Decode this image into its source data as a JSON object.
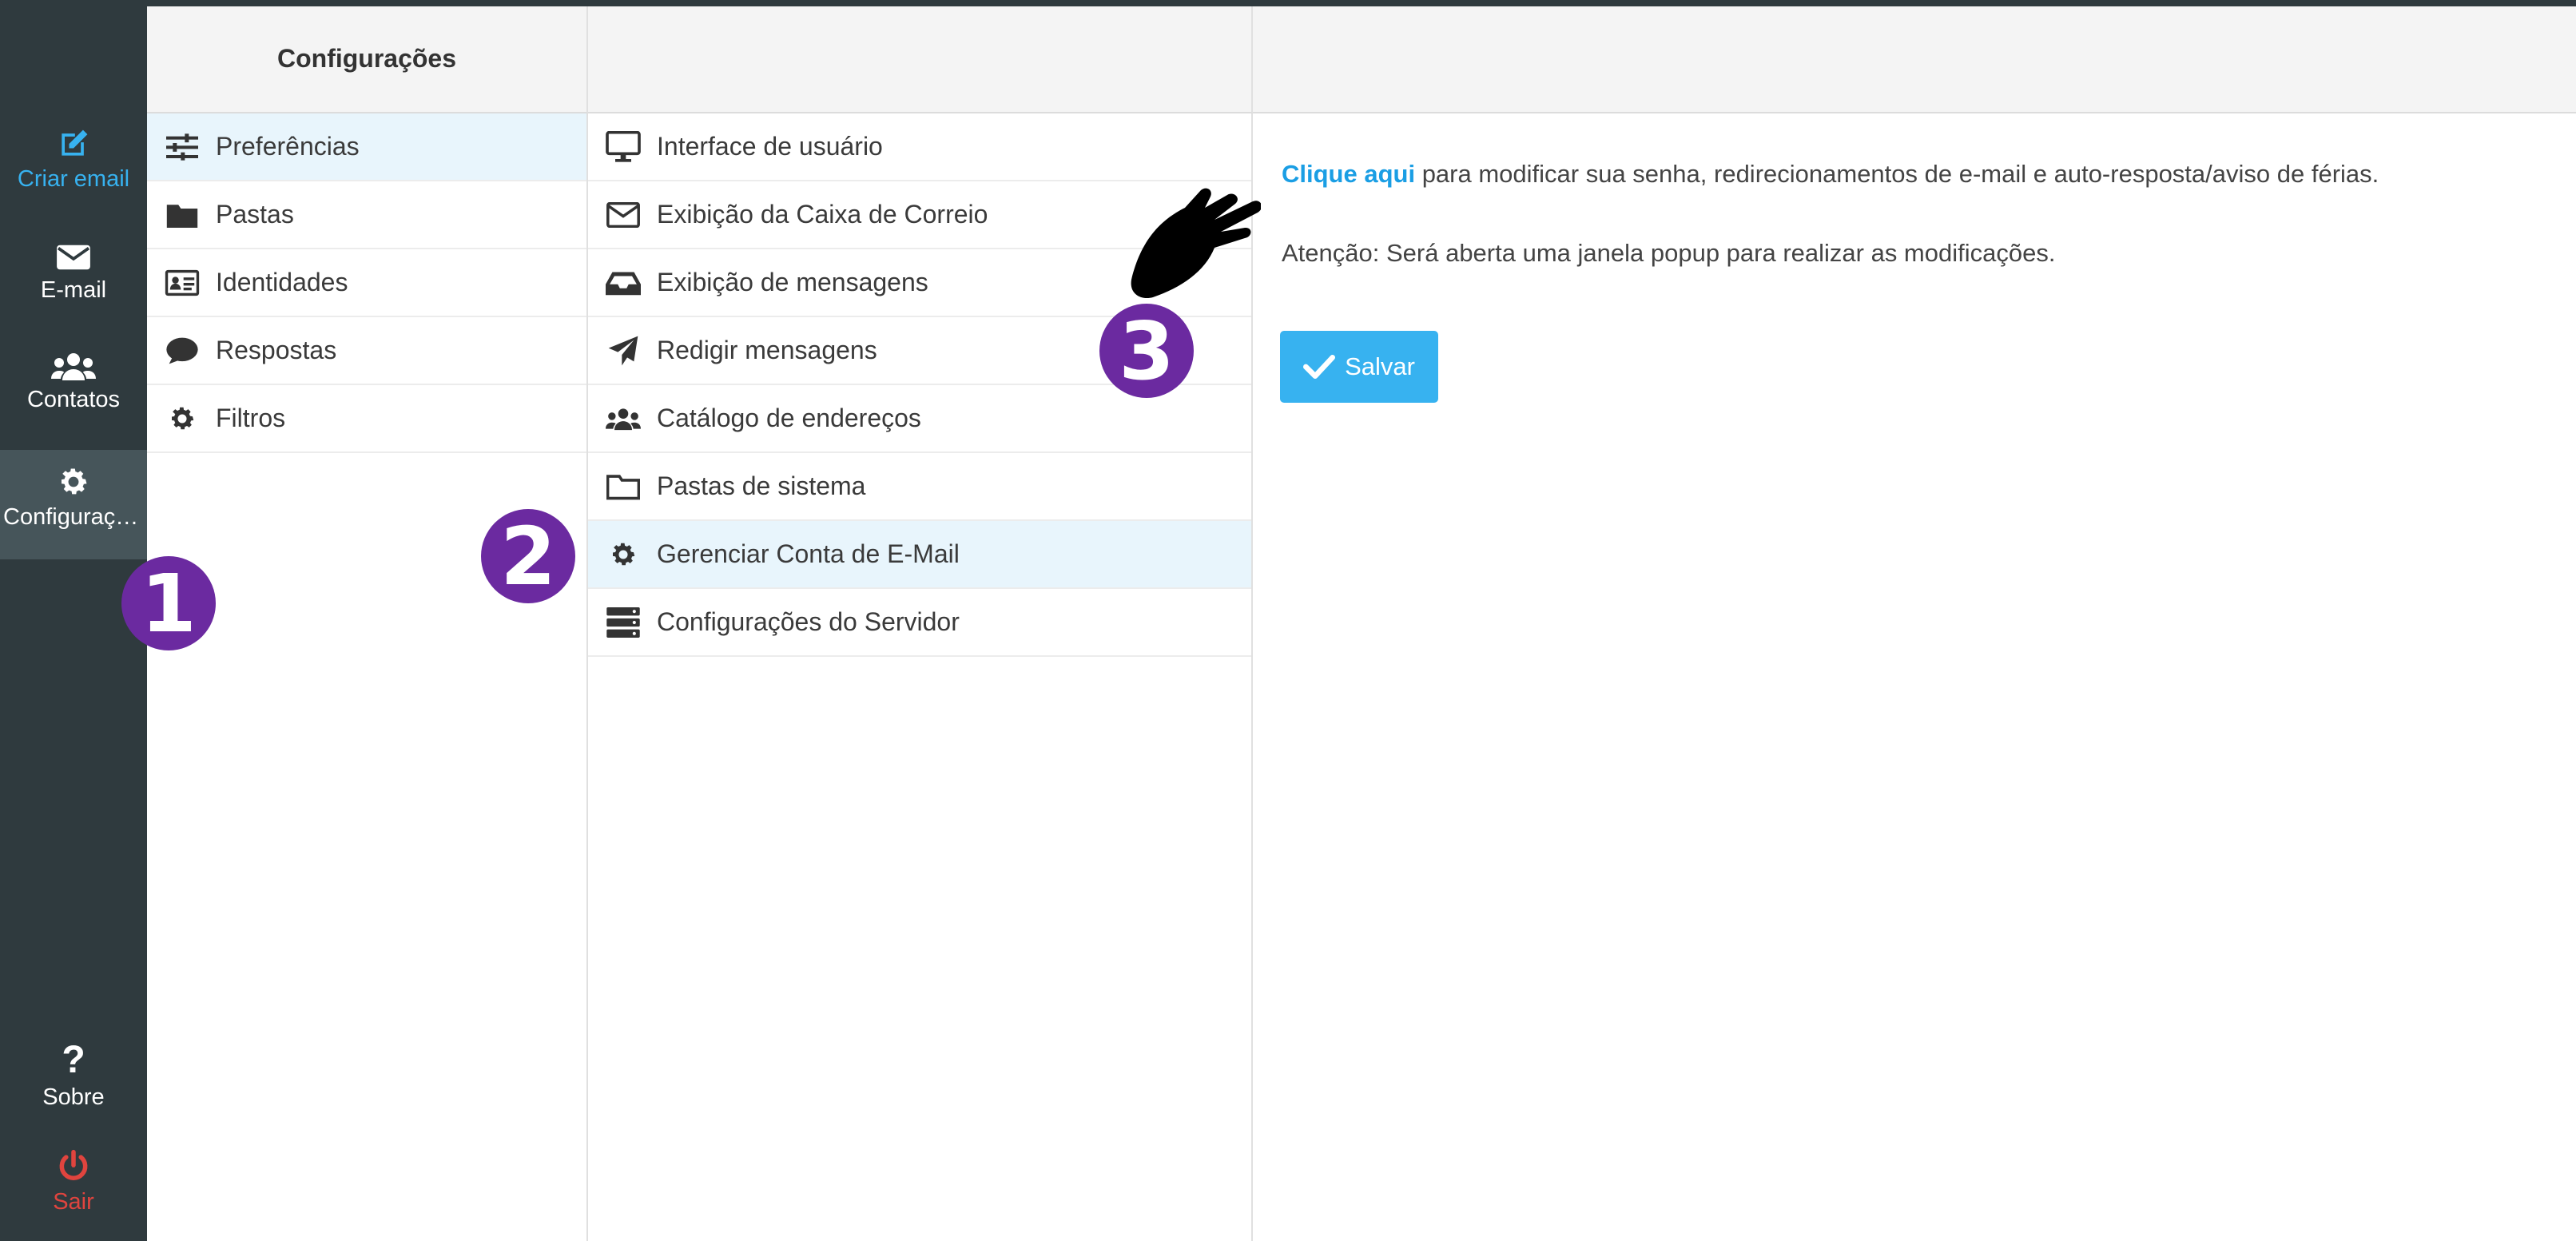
{
  "nav": {
    "compose": "Criar email",
    "mail": "E-mail",
    "contacts": "Contatos",
    "settings": "Configurações",
    "about": "Sobre",
    "logout": "Sair"
  },
  "settings_header": "Configurações",
  "sections": [
    {
      "label": "Preferências",
      "icon": "sliders-icon",
      "active": true
    },
    {
      "label": "Pastas",
      "icon": "folder-icon"
    },
    {
      "label": "Identidades",
      "icon": "id-card-icon"
    },
    {
      "label": "Respostas",
      "icon": "comment-icon"
    },
    {
      "label": "Filtros",
      "icon": "gear-icon"
    }
  ],
  "preferences": [
    {
      "label": "Interface de usuário",
      "icon": "monitor-icon"
    },
    {
      "label": "Exibição da Caixa de Correio",
      "icon": "envelope-icon"
    },
    {
      "label": "Exibição de mensagens",
      "icon": "inbox-icon"
    },
    {
      "label": "Redigir mensagens",
      "icon": "paper-plane-icon"
    },
    {
      "label": "Catálogo de endereços",
      "icon": "users-icon"
    },
    {
      "label": "Pastas de sistema",
      "icon": "folder-outline-icon"
    },
    {
      "label": "Gerenciar Conta de E-Mail",
      "icon": "gear-icon",
      "active": true
    },
    {
      "label": "Configurações do Servidor",
      "icon": "server-icon"
    }
  ],
  "content": {
    "link_text": "Clique aqui",
    "line1_rest": " para modificar sua senha, redirecionamentos de e-mail e auto-resposta/aviso de férias.",
    "line2": "Atenção: Será aberta uma janela popup para realizar as modificações.",
    "save_label": "Salvar"
  },
  "annotations": {
    "step1": "1",
    "step2": "2",
    "step3": "3"
  },
  "colors": {
    "sidebar": "#2f3a3e",
    "accent": "#37b2f0",
    "active_row": "#e8f5fc",
    "logout": "#e0443e",
    "badge": "#6b2aa0"
  }
}
